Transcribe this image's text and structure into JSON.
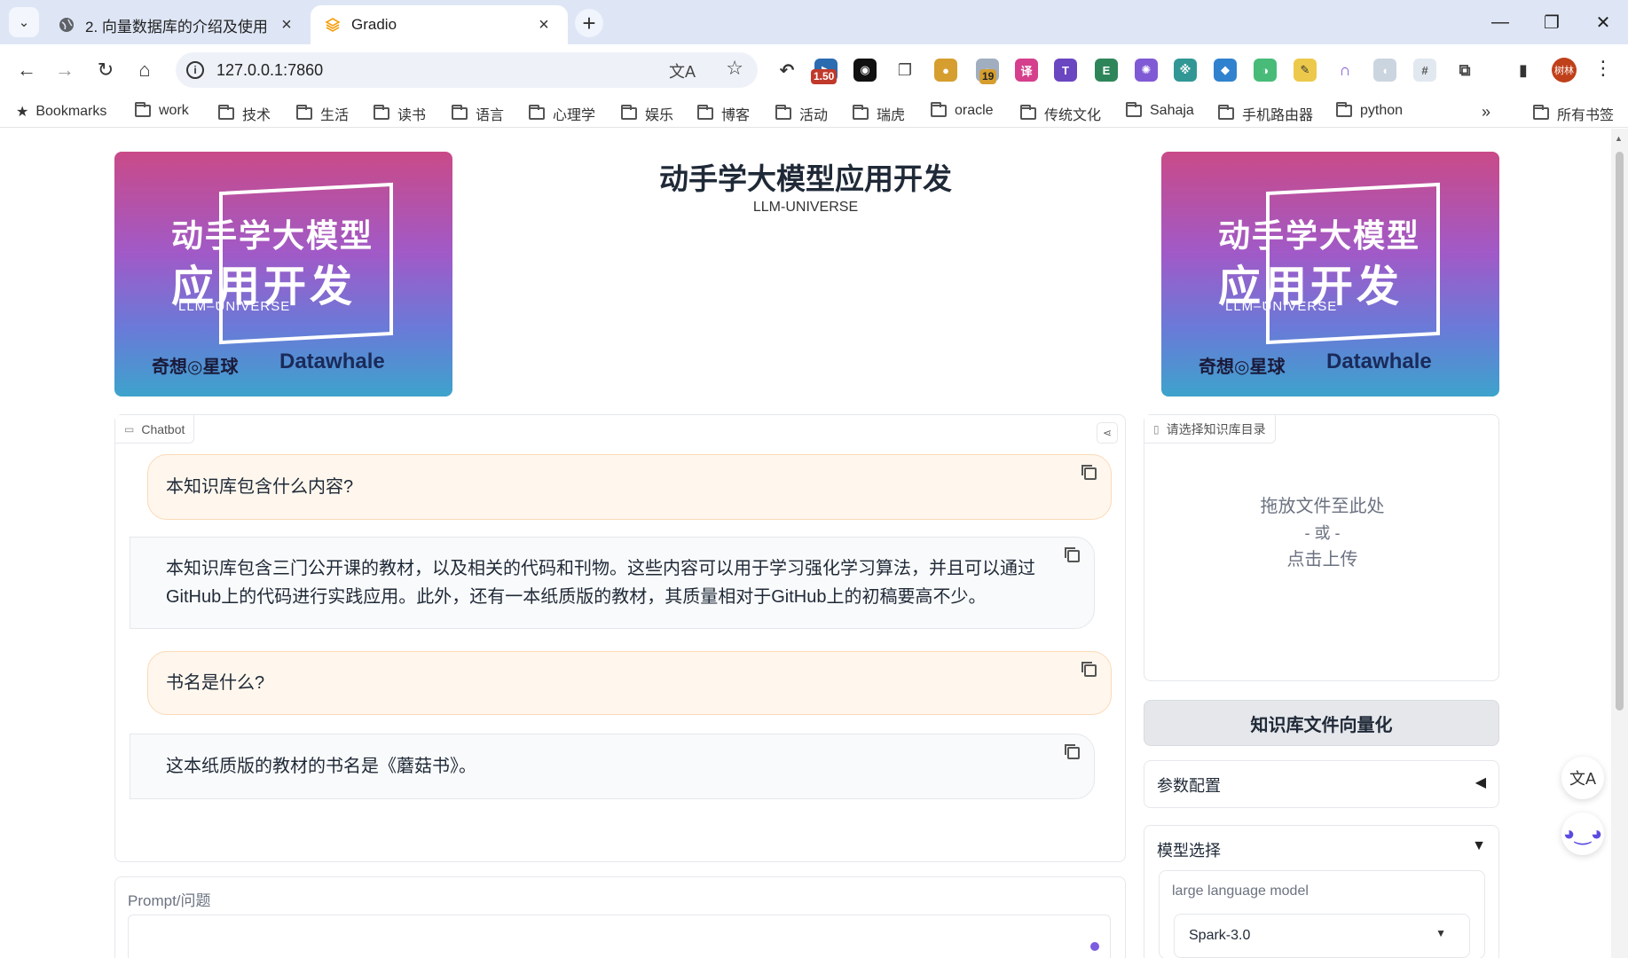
{
  "browser": {
    "tabs": [
      {
        "title": "2. 向量数据库的介绍及使用",
        "active": false
      },
      {
        "title": "Gradio",
        "active": true
      }
    ],
    "url": "127.0.0.1:7860",
    "extension_badges": {
      "speed": "1.50",
      "count": "19"
    },
    "profile_label": "树林",
    "bookmarks_label": "Bookmarks",
    "bookmark_folders": [
      "work",
      "技术",
      "生活",
      "读书",
      "语言",
      "心理学",
      "娱乐",
      "博客",
      "活动",
      "瑞虎",
      "oracle",
      "传统文化",
      "Sahaja",
      "手机路由器",
      "python"
    ],
    "all_bookmarks_label": "所有书签"
  },
  "banner": {
    "line1": "动手学大模型",
    "line2": "应用开发",
    "sub": "LLM–UNIVERSE",
    "brand_a": "奇想◎星球",
    "brand_b": "Datawhale"
  },
  "header": {
    "title": "动手学大模型应用开发",
    "subtitle": "LLM-UNIVERSE"
  },
  "chatbot": {
    "label": "Chatbot",
    "messages": [
      {
        "role": "user",
        "text": "本知识库包含什么内容?"
      },
      {
        "role": "bot",
        "text": "本知识库包含三门公开课的教材，以及相关的代码和刊物。这些内容可以用于学习强化学习算法，并且可以通过GitHub上的代码进行实践应用。此外，还有一本纸质版的教材，其质量相对于GitHub上的初稿要高不少。"
      },
      {
        "role": "user",
        "text": "书名是什么?"
      },
      {
        "role": "bot",
        "text": "这本纸质版的教材的书名是《蘑菇书》。"
      }
    ]
  },
  "prompt": {
    "label": "Prompt/问题",
    "value": ""
  },
  "upload": {
    "label": "请选择知识库目录",
    "drop_line1": "拖放文件至此处",
    "drop_line2": "- 或 -",
    "drop_line3": "点击上传"
  },
  "vectorize_button": "知识库文件向量化",
  "params_accordion": {
    "label": "参数配置",
    "state": "collapsed"
  },
  "model_accordion": {
    "label": "模型选择",
    "state": "expanded",
    "llm_label": "large language model",
    "llm_value": "Spark-3.0"
  },
  "colors": {
    "user_bubble": "#fff7ed",
    "bot_bubble": "#f9fafb",
    "accent": "#7c5ce0"
  }
}
